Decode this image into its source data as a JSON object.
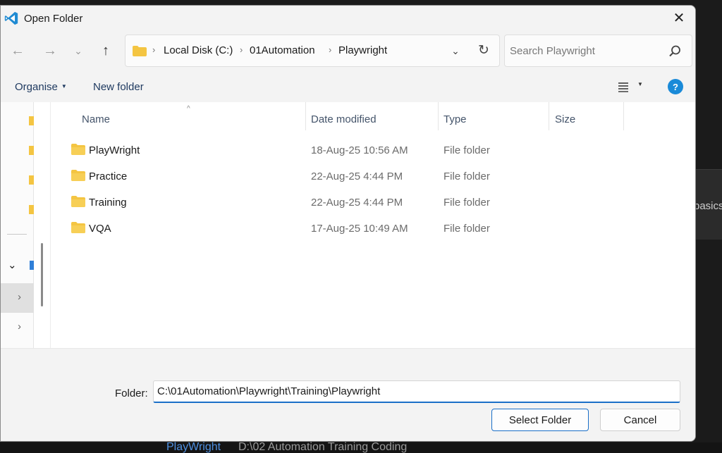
{
  "background": {
    "side_text": "basics",
    "recent_name": "PlayWright",
    "recent_path": "D:\\02 Automation Training Coding"
  },
  "dialog": {
    "title": "Open Folder",
    "close_icon": "close-icon"
  },
  "nav": {
    "breadcrumb": [
      "Local Disk (C:)",
      "01Automation",
      "Playwright"
    ],
    "search_placeholder": "Search Playwright"
  },
  "commands": {
    "organise": "Organise",
    "new_folder": "New folder",
    "help": "?"
  },
  "columns": {
    "name": "Name",
    "date_modified": "Date modified",
    "type": "Type",
    "size": "Size"
  },
  "files": [
    {
      "name": "PlayWright",
      "date": "18-Aug-25 10:56 AM",
      "type": "File folder"
    },
    {
      "name": "Practice",
      "date": "22-Aug-25 4:44 PM",
      "type": "File folder"
    },
    {
      "name": "Training",
      "date": "22-Aug-25 4:44 PM",
      "type": "File folder"
    },
    {
      "name": "VQA",
      "date": "17-Aug-25 10:49 AM",
      "type": "File folder"
    }
  ],
  "footer": {
    "folder_label": "Folder:",
    "folder_value": "C:\\01Automation\\Playwright\\Training\\Playwright",
    "select_button": "Select Folder",
    "cancel_button": "Cancel"
  },
  "colors": {
    "accent": "#1a6fc8",
    "folder": "#f4c542",
    "help_icon": "#1a8ad8"
  }
}
